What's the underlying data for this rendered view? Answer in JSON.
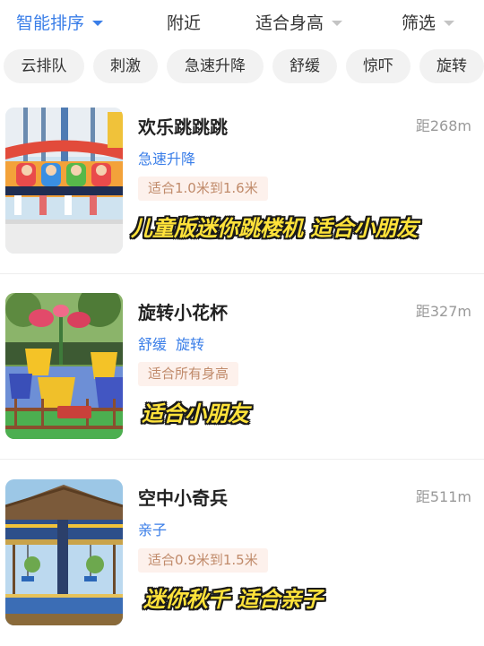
{
  "sort_bar": {
    "smart_sort": "智能排序",
    "nearby": "附近",
    "height": "适合身高",
    "filter": "筛选"
  },
  "categories": [
    "云排队",
    "刺激",
    "急速升降",
    "舒缓",
    "惊吓",
    "旋转"
  ],
  "rides": [
    {
      "name": "欢乐跳跳跳",
      "distance": "距268m",
      "tags": [
        "急速升降"
      ],
      "height_range": "适合1.0米到1.6米",
      "caption": "儿童版迷你跳楼机 适合小朋友"
    },
    {
      "name": "旋转小花杯",
      "distance": "距327m",
      "tags": [
        "舒缓",
        "旋转"
      ],
      "height_range": "适合所有身高",
      "caption": "适合小朋友"
    },
    {
      "name": "空中小奇兵",
      "distance": "距511m",
      "tags": [
        "亲子"
      ],
      "height_range": "适合0.9米到1.5米",
      "caption": "迷你秋千 适合亲子"
    }
  ],
  "colors": {
    "accent_blue": "#3a7ee8",
    "badge_bg": "#fdf1ec",
    "badge_text": "#c08a6a",
    "caption_yellow": "#ffe23a"
  }
}
